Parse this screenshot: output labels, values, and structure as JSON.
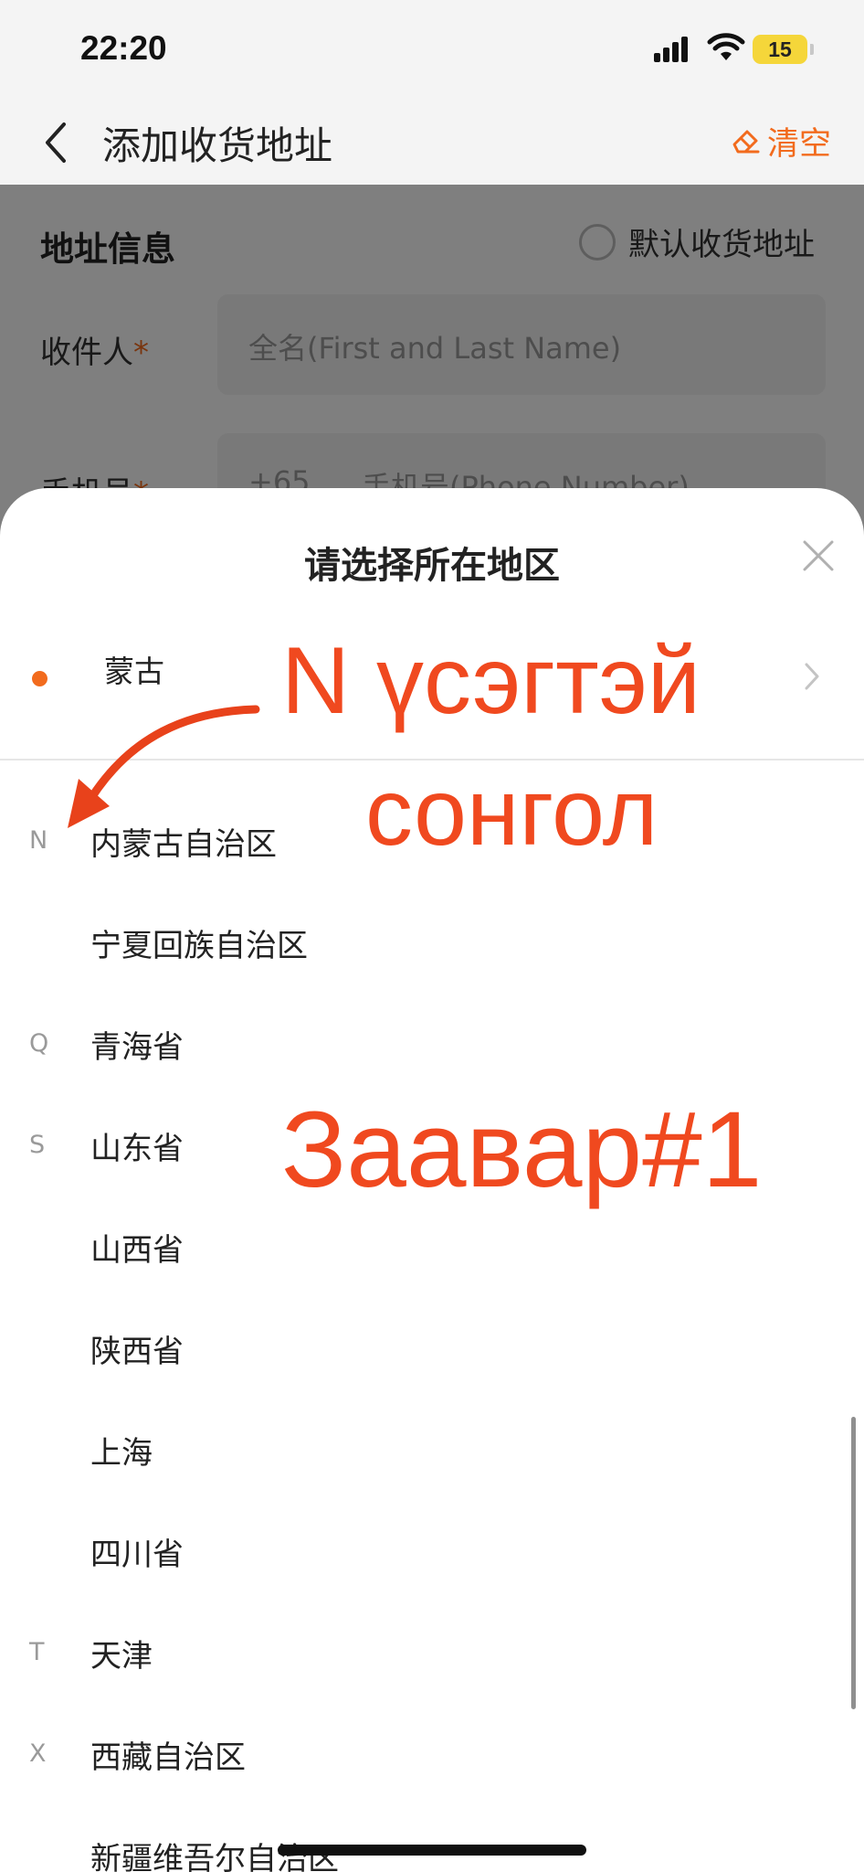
{
  "status_bar": {
    "time": "22:20",
    "battery": "15"
  },
  "nav": {
    "title": "添加收货地址",
    "clear_label": "清空"
  },
  "form": {
    "section_title": "地址信息",
    "default_label": "默认收货地址",
    "recipient_label": "收件人",
    "recipient_placeholder": "全名(First and Last Name)",
    "phone_label": "手机号",
    "phone_code": "+65",
    "phone_placeholder": "手机号(Phone Number)",
    "required_mark": "*"
  },
  "sheet": {
    "title": "请选择所在地区",
    "selected": "蒙古",
    "regions": [
      {
        "letter": "N",
        "name": "内蒙古自治区"
      },
      {
        "letter": "",
        "name": "宁夏回族自治区"
      },
      {
        "letter": "Q",
        "name": "青海省"
      },
      {
        "letter": "S",
        "name": "山东省"
      },
      {
        "letter": "",
        "name": "山西省"
      },
      {
        "letter": "",
        "name": "陕西省"
      },
      {
        "letter": "",
        "name": "上海"
      },
      {
        "letter": "",
        "name": "四川省"
      },
      {
        "letter": "T",
        "name": "天津"
      },
      {
        "letter": "X",
        "name": "西藏自治区"
      },
      {
        "letter": "",
        "name": "新疆维吾尔自治区"
      }
    ]
  },
  "annotations": {
    "line1": "N үсэгтэй",
    "line2": "сонгол",
    "line3": "Заавар#1"
  },
  "colors": {
    "accent": "#f26b1d",
    "annotation": "#f0491f"
  },
  "icons": [
    "signal-icon",
    "wifi-icon",
    "back-icon",
    "eraser-icon",
    "close-icon",
    "chevron-right-icon",
    "arrow-icon"
  ]
}
